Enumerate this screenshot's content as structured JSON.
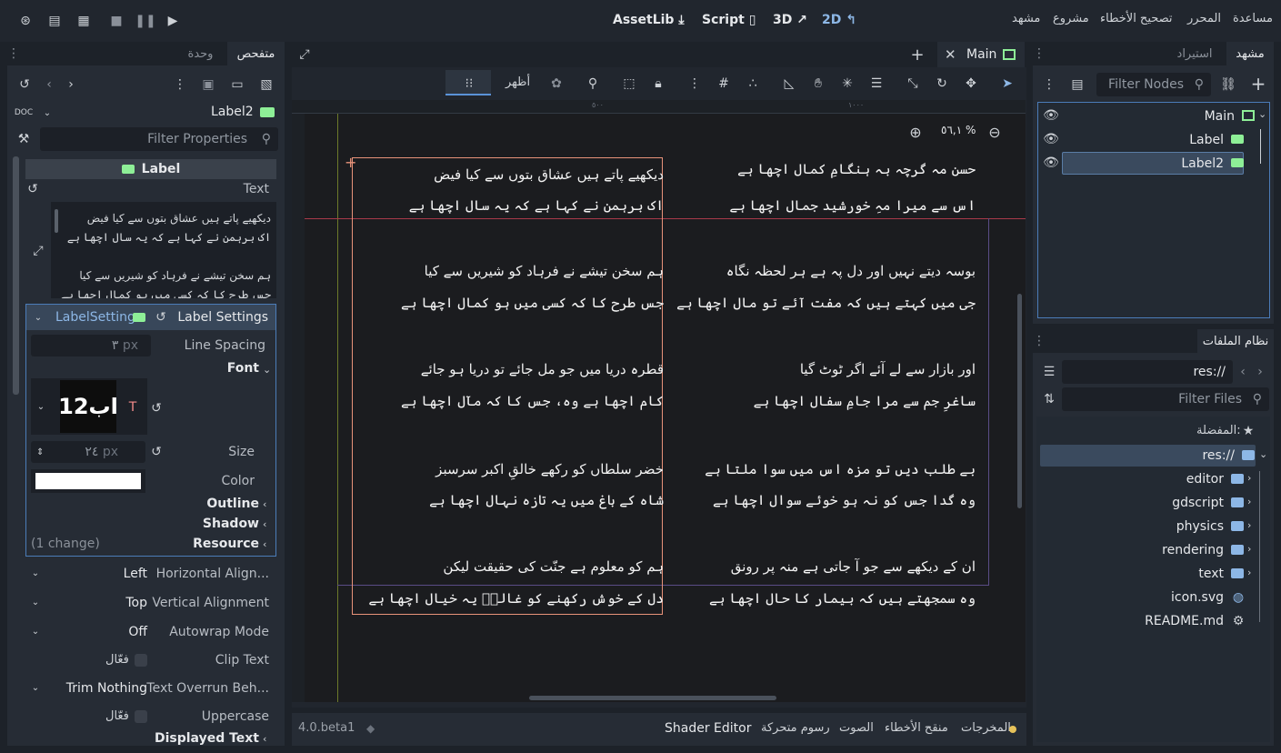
{
  "topbar": {
    "menu": [
      "مساعدة",
      "المحرر",
      "تصحيح الأخطاء",
      "مشروع",
      "مشهد"
    ],
    "assetlib": "AssetLib",
    "script": "Script",
    "three_d": "3D",
    "two_d": "2D"
  },
  "inspector": {
    "tabs": [
      "متفحص",
      "وحدة"
    ],
    "node_name": "Label2",
    "filter_placeholder": "Filter Properties",
    "section_label": "Label",
    "text_label": "Text",
    "text_lines": [
      "دیکھیے پاتے ہیں عشاق بتوں سے کیا فیض",
      "اک برہمن نے کہا ہے کہ یہ سال اچھا ہے",
      "",
      "ہم سخن تیشے نے فرہاد کو شیریں سے کیا",
      "جس طرح کا کہ کسی میں ہو کمال اچھا ہے"
    ],
    "label_settings_label": "Label Settings",
    "label_settings_value": "LabelSetting",
    "line_spacing_label": "Line Spacing",
    "line_spacing_value": "٣",
    "px": "px",
    "font_label": "Font",
    "font_preview": "12اب",
    "size_label": "Size",
    "size_value": "٢٤",
    "color_label": "Color",
    "outline_label": "Outline",
    "shadow_label": "Shadow",
    "resource_label": "Resource",
    "changes": "(1 change)",
    "h_align_label": "Horizontal Align...",
    "h_align_value": "Left",
    "v_align_label": "Vertical Alignment",
    "v_align_value": "Top",
    "autowrap_label": "Autowrap Mode",
    "autowrap_value": "Off",
    "clip_label": "Clip Text",
    "clip_value": "فعّال",
    "overrun_label": "Text Overrun Beh...",
    "overrun_value": "Trim Nothing",
    "uppercase_label": "Uppercase",
    "uppercase_value": "فعّال",
    "displayed_label": "Displayed Text"
  },
  "editor": {
    "tab_title": "Main",
    "show_label": "أظهر",
    "zoom": "٥٦,١ %",
    "poem_right": [
      "حسن مہ گرچہ بہ ہنگامِ کمال اچھا ہے",
      "اس سے میرا مہِ خورشید جمال اچھا ہے",
      "بوسہ دیتے نہیں اور دل پہ ہے ہر لحظہ نگاہ",
      "جی میں کہتے ہیں کہ مفت آئے تو مال اچھا ہے",
      "اور بازار سے لے آئے اگر ٹوٹ گیا",
      "ساغرِ جم سے مرا جامِ سفال اچھا ہے",
      "بے طلب دیں تو مزہ اس میں سوا ملتا ہے",
      "وہ گدا جس کو نہ ہو خوئے سوال اچھا ہے",
      "ان کے دیکھے سے جو آ جاتی ہے منہ پر رونق",
      "وہ سمجھتے ہیں کہ بیمار کا حال اچھا ہے"
    ],
    "poem_left": [
      "دیکھیے پاتے ہیں عشاق بتوں سے کیا فیض",
      "اک برہمن نے کہا ہے کہ یہ سال اچھا ہے",
      "ہم سخن تیشے نے فرہاد کو شیریں سے کیا",
      "جس طرح کا کہ کسی میں ہو کمال اچھا ہے",
      "قطرہ دریا میں جو مل جائے تو دریا ہو جائے",
      "کام اچھا ہے وہ، جس کا کہ مآل اچھا ہے",
      "خضر سلطاں کو رکھے خالقِ اکبر سرسبز",
      "شاہ کے باغ میں یہ تازہ نہال اچھا ہے",
      "ہم کو معلوم ہے جنّت کی حقیقت لیکن",
      "دل کے خوش رکھنے کو غالبؔ یہ خیال اچھا ہے"
    ],
    "ruler_marks": [
      "٥٠٠",
      "١٠٠٠"
    ]
  },
  "bottombar": {
    "version": "4.0.beta1",
    "items": [
      "Shader Editor",
      "رسوم متحركة",
      "الصوت",
      "منقح الأخطاء",
      "المخرجات"
    ]
  },
  "scene": {
    "tabs": [
      "مشهد",
      "استيراد"
    ],
    "filter_placeholder": "Filter Nodes",
    "nodes": [
      "Main",
      "Label",
      "Label2"
    ]
  },
  "filesystem": {
    "tab": "نظام الملفات",
    "path": "res://",
    "filter_placeholder": "Filter Files",
    "favorites": "المفضلة:",
    "items": [
      "res://",
      "editor",
      "gdscript",
      "physics",
      "rendering",
      "text",
      "icon.svg",
      "README.md"
    ]
  }
}
